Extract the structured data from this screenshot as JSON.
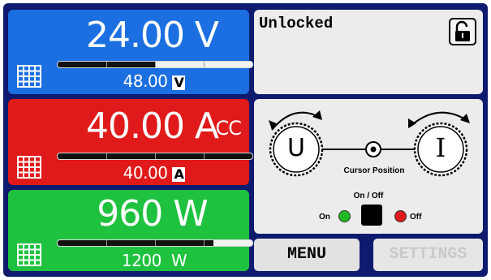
{
  "voltage": {
    "value": "24.00 V",
    "limit": "48.00",
    "unit": "V",
    "level": 0.5,
    "color": "#1b6fe0"
  },
  "current": {
    "value": "40.00 A",
    "mode": "CC",
    "limit": "40.00",
    "unit": "A",
    "level": 1.0,
    "color": "#e01a1a"
  },
  "power": {
    "value": "960 W",
    "limit": "1200",
    "unit": "W",
    "level": 0.8,
    "color": "#1fc23f"
  },
  "lock": {
    "status": "Unlocked"
  },
  "knobs": {
    "left_label": "U",
    "right_label": "I",
    "cursor_label": "Cursor Position"
  },
  "output": {
    "title": "On / Off",
    "on_label": "On",
    "off_label": "Off"
  },
  "buttons": {
    "menu": "MENU",
    "settings": "SETTINGS"
  }
}
